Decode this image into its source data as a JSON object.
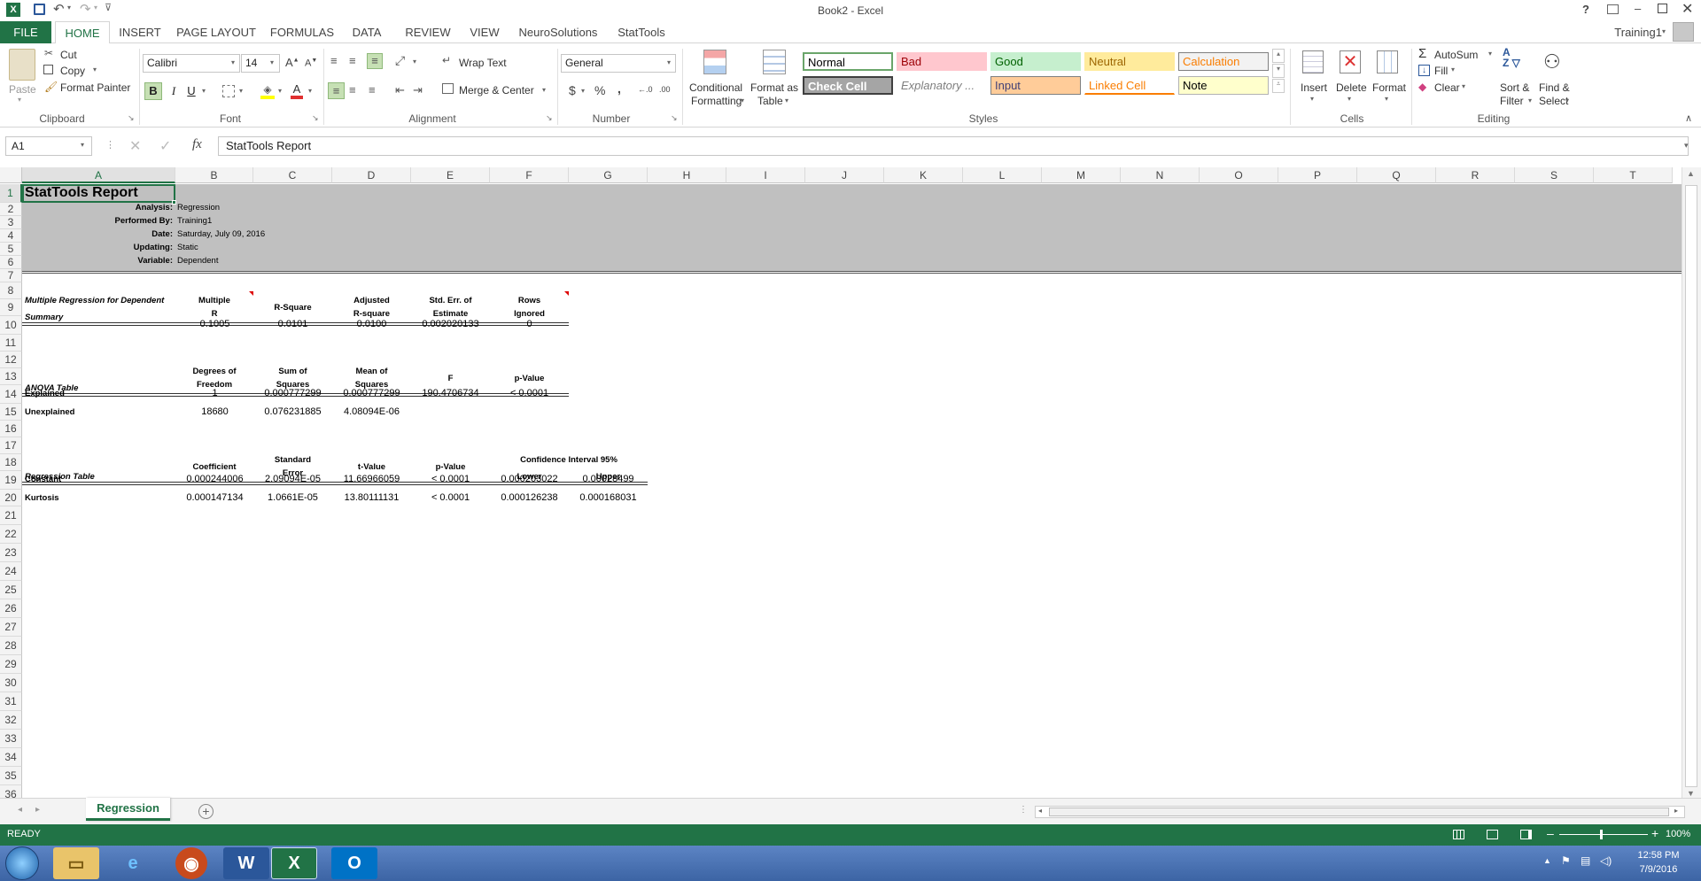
{
  "window": {
    "title": "Book2 - Excel",
    "user": "Training1",
    "help": "?"
  },
  "qat": {
    "app_icon": "X"
  },
  "tabs": [
    "FILE",
    "HOME",
    "INSERT",
    "PAGE LAYOUT",
    "FORMULAS",
    "DATA",
    "REVIEW",
    "VIEW",
    "NeuroSolutions",
    "StatTools"
  ],
  "clipboard": {
    "paste": "Paste",
    "cut": "Cut",
    "copy": "Copy",
    "format_painter": "Format Painter",
    "label": "Clipboard"
  },
  "font": {
    "name": "Calibri",
    "size": "14",
    "label": "Font",
    "bold": "B",
    "italic": "I",
    "underline": "U"
  },
  "alignment": {
    "wrap": "Wrap Text",
    "merge": "Merge & Center",
    "label": "Alignment"
  },
  "number": {
    "format": "General",
    "currency": "$",
    "percent": "%",
    "comma": ",",
    "label": "Number"
  },
  "styles": {
    "cond1": "Conditional",
    "cond2": "Formatting",
    "fmt1": "Format as",
    "fmt2": "Table",
    "boxes": [
      {
        "label": "Normal",
        "bg": "#ffffff",
        "fg": "#000000",
        "border": "#6aa56a"
      },
      {
        "label": "Bad",
        "bg": "#ffc7ce",
        "fg": "#9c0006",
        "border": "#ffc7ce"
      },
      {
        "label": "Good",
        "bg": "#c6efce",
        "fg": "#006100",
        "border": "#c6efce"
      },
      {
        "label": "Neutral",
        "bg": "#ffeb9c",
        "fg": "#9c6500",
        "border": "#ffeb9c"
      },
      {
        "label": "Calculation",
        "bg": "#f2f2f2",
        "fg": "#fa7d00",
        "border": "#7f7f7f"
      },
      {
        "label": "Check Cell",
        "bg": "#a5a5a5",
        "fg": "#ffffff",
        "border": "#3f3f3f"
      },
      {
        "label": "Explanatory ...",
        "bg": "#ffffff",
        "fg": "#7f7f7f",
        "border": "#ffffff"
      },
      {
        "label": "Input",
        "bg": "#ffcc99",
        "fg": "#3f3f76",
        "border": "#7f7f7f"
      },
      {
        "label": "Linked Cell",
        "bg": "#ffffff",
        "fg": "#fa7d00",
        "border": "#ffffff"
      },
      {
        "label": "Note",
        "bg": "#ffffcc",
        "fg": "#000000",
        "border": "#b2b2b2"
      }
    ],
    "label": "Styles"
  },
  "cells_grp": {
    "insert": "Insert",
    "delete": "Delete",
    "format": "Format",
    "label": "Cells"
  },
  "editing": {
    "autosum": "AutoSum",
    "fill": "Fill",
    "clear": "Clear",
    "sort1": "Sort &",
    "sort2": "Filter",
    "find1": "Find &",
    "find2": "Select",
    "label": "Editing"
  },
  "formula_bar": {
    "name_box": "A1",
    "fx": "fx",
    "content": "StatTools Report"
  },
  "columns": [
    "A",
    "B",
    "C",
    "D",
    "E",
    "F",
    "G",
    "H",
    "I",
    "J",
    "K",
    "L",
    "M",
    "N",
    "O",
    "P",
    "Q",
    "R",
    "S",
    "T"
  ],
  "rows": [
    "1",
    "2",
    "3",
    "4",
    "5",
    "6",
    "7",
    "8",
    "9",
    "10",
    "11",
    "12",
    "13",
    "14",
    "15",
    "16",
    "17",
    "18",
    "19",
    "20",
    "21",
    "22",
    "23",
    "24",
    "25",
    "26",
    "27",
    "28",
    "29",
    "30",
    "31",
    "32",
    "33",
    "34",
    "35",
    "36"
  ],
  "report": {
    "title": "StatTools Report",
    "meta": [
      {
        "k": "Analysis:",
        "v": "Regression"
      },
      {
        "k": "Performed By:",
        "v": "Training1"
      },
      {
        "k": "Date:",
        "v": "Saturday, July 09, 2016"
      },
      {
        "k": "Updating:",
        "v": "Static"
      },
      {
        "k": "Variable:",
        "v": "Dependent"
      }
    ],
    "summary": {
      "title1": "Multiple Regression for Dependent",
      "title2": "Summary",
      "h_mr1": "Multiple",
      "h_mr2": "R",
      "h_rsq": "R-Square",
      "h_adj1": "Adjusted",
      "h_adj2": "R-square",
      "h_se1": "Std. Err. of",
      "h_se2": "Estimate",
      "h_ri1": "Rows",
      "h_ri2": "Ignored",
      "values": [
        "0.1005",
        "0.0101",
        "0.0100",
        "0.002020133",
        "0"
      ]
    },
    "anova": {
      "title": "ANOVA Table",
      "h_df1": "Degrees of",
      "h_df2": "Freedom",
      "h_ss1": "Sum of",
      "h_ss2": "Squares",
      "h_ms1": "Mean of",
      "h_ms2": "Squares",
      "h_f": "F",
      "h_p": "p-Value",
      "rows": [
        {
          "label": "Explained",
          "df": "1",
          "ss": "0.000777299",
          "ms": "0.000777299",
          "f": "190.4706734",
          "p": "< 0.0001"
        },
        {
          "label": "Unexplained",
          "df": "18680",
          "ss": "0.076231885",
          "ms": "4.08094E-06",
          "f": "",
          "p": ""
        }
      ]
    },
    "regression": {
      "title": "Regression Table",
      "h_coef": "Coefficient",
      "h_se1": "Standard",
      "h_se2": "Error",
      "h_t": "t-Value",
      "h_p": "p-Value",
      "h_ci": "Confidence Interval 95%",
      "h_lo": "Lower",
      "h_up": "Upper",
      "rows": [
        {
          "label": "Constant",
          "coef": "0.000244006",
          "se": "2.09094E-05",
          "t": "11.66966059",
          "p": "< 0.0001",
          "lo": "0.000203022",
          "up": "0.00028499"
        },
        {
          "label": "Kurtosis",
          "coef": "0.000147134",
          "se": "1.0661E-05",
          "t": "13.80111131",
          "p": "< 0.0001",
          "lo": "0.000126238",
          "up": "0.000168031"
        }
      ]
    }
  },
  "sheet_tab": "Regression",
  "status": {
    "ready": "READY",
    "zoom": "100%"
  },
  "taskbar": {
    "time": "12:58 PM",
    "date": "7/9/2016"
  }
}
